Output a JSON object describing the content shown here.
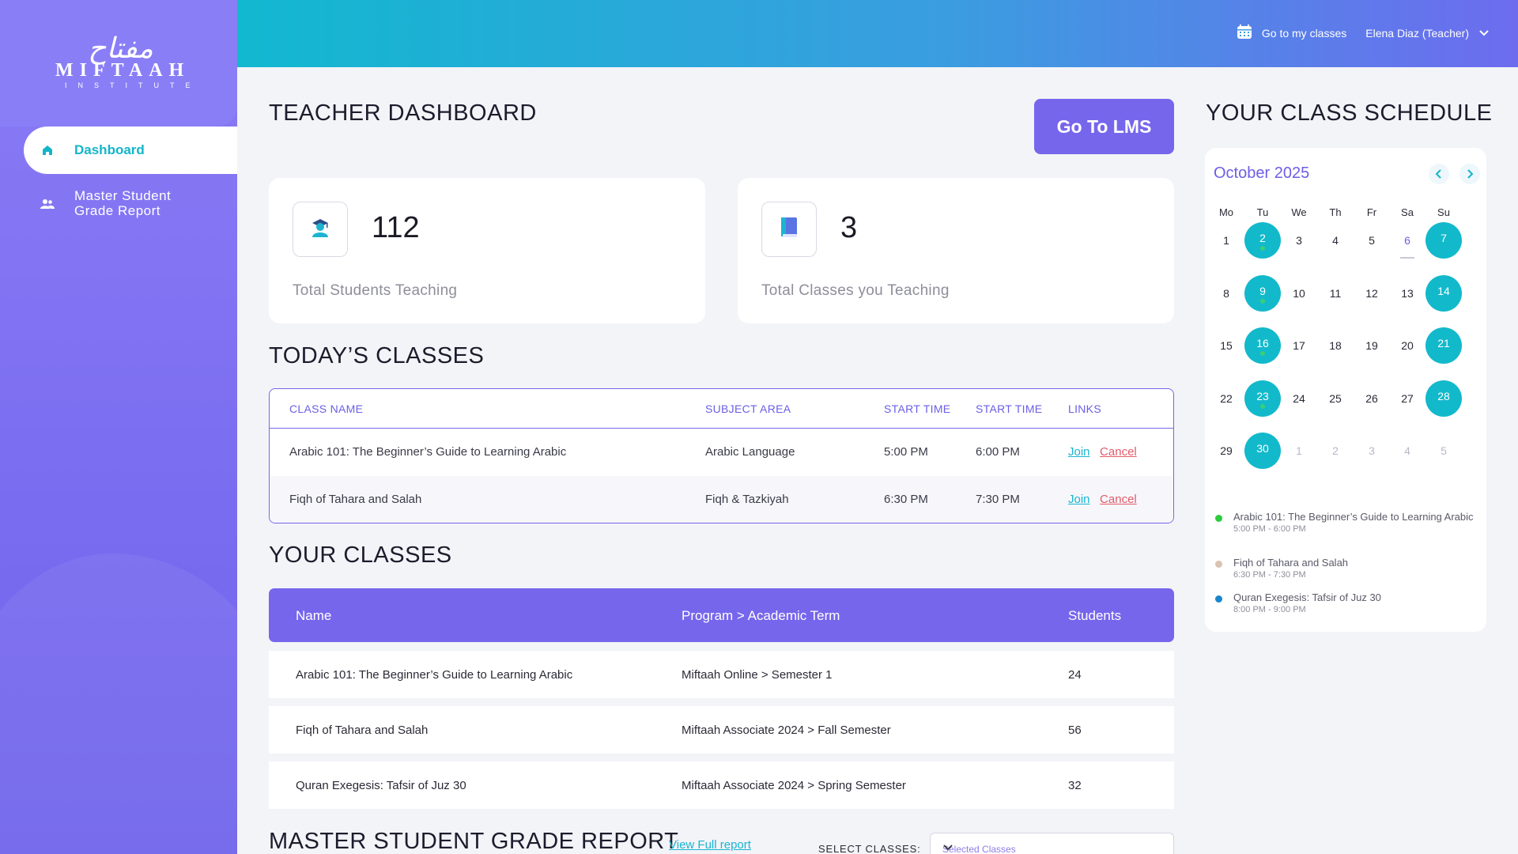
{
  "brand": {
    "arabic": "مفتاح",
    "name": "MIFTAAH",
    "sub": "INSTITUTE"
  },
  "sidebar": {
    "items": [
      {
        "label": "Dashboard"
      },
      {
        "label_line1": "Master Student",
        "label_line2": "Grade Report"
      }
    ]
  },
  "topbar": {
    "my_classes": "Go to my classes",
    "user": "Elena Diaz (Teacher)"
  },
  "dashboard": {
    "title": "TEACHER DASHBOARD",
    "lms_button": "Go To LMS",
    "stats": [
      {
        "value": "112",
        "label": "Total Students Teaching"
      },
      {
        "value": "3",
        "label": "Total Classes you Teaching"
      }
    ]
  },
  "today": {
    "title": "TODAY’S CLASSES",
    "headers": [
      "CLASS NAME",
      "SUBJECT AREA",
      "START TIME",
      "START TIME",
      "LINKS"
    ],
    "rows": [
      {
        "name": "Arabic 101: The Beginner’s Guide to Learning Arabic",
        "subject": "Arabic Language",
        "start": "5:00 PM",
        "end": "6:00 PM",
        "join": "Join",
        "cancel": "Cancel"
      },
      {
        "name": "Fiqh of Tahara and Salah",
        "subject": "Fiqh & Tazkiyah",
        "start": "6:30 PM",
        "end": "7:30 PM",
        "join": "Join",
        "cancel": "Cancel"
      }
    ]
  },
  "classes": {
    "title": "YOUR CLASSES",
    "headers": [
      "Name",
      "Program > Academic Term",
      "Students"
    ],
    "rows": [
      {
        "name": "Arabic 101: The Beginner’s Guide to Learning Arabic",
        "program": "Miftaah Online > Semester 1",
        "students": "24"
      },
      {
        "name": "Fiqh of Tahara and Salah",
        "program": "Miftaah Associate 2024 > Fall Semester",
        "students": "56"
      },
      {
        "name": "Quran Exegesis: Tafsir of Juz 30",
        "program": "Miftaah Associate 2024 > Spring Semester",
        "students": "32"
      }
    ]
  },
  "report": {
    "title": "MASTER STUDENT GRADE REPORT",
    "link": "View Full report",
    "select_label": "SELECT CLASSES:",
    "select_placeholder": "Selected Classes"
  },
  "schedule": {
    "title": "YOUR CLASS SCHEDULE",
    "month": "October 2025",
    "weekdays": [
      "Mo",
      "Tu",
      "We",
      "Th",
      "Fr",
      "Sa",
      "Su"
    ],
    "weeks": [
      [
        "1",
        "2",
        "3",
        "4",
        "5",
        "6",
        "7"
      ],
      [
        "8",
        "9",
        "10",
        "11",
        "12",
        "13",
        "14"
      ],
      [
        "15",
        "16",
        "17",
        "18",
        "19",
        "20",
        "21"
      ],
      [
        "22",
        "23",
        "24",
        "25",
        "26",
        "27",
        "28"
      ],
      [
        "29",
        "30",
        "1",
        "2",
        "3",
        "4",
        "5"
      ]
    ],
    "events": [
      {
        "title": "Arabic 101: The Beginner’s Guide to Learning Arabic",
        "time": "5:00 PM - 6:00 PM",
        "color": "#2ecc40"
      },
      {
        "title": "Fiqh of Tahara and Salah",
        "time": "6:30 PM - 7:30 PM",
        "color": "#d9c3b0"
      },
      {
        "title": "Quran Exegesis: Tafsir of Juz 30",
        "time": "8:00 PM - 9:00 PM",
        "color": "#1a85c9"
      }
    ]
  },
  "colors": {
    "accent": "#7666ec",
    "teal": "#12b9cb",
    "join": "#1ab4d0",
    "cancel": "#e25a6a"
  }
}
